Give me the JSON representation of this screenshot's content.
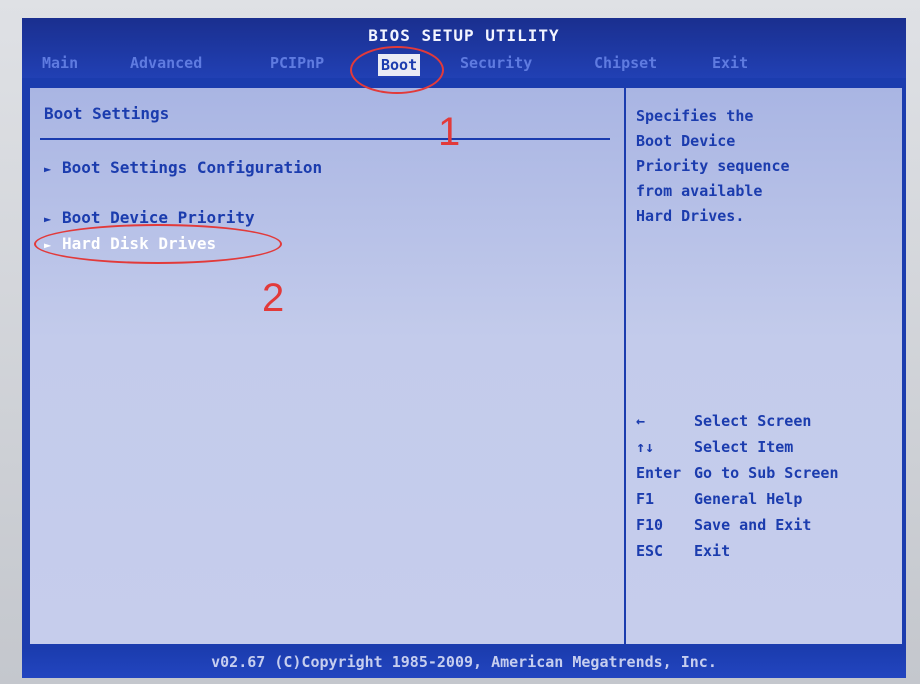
{
  "bios": {
    "title": "BIOS SETUP UTILITY",
    "menu": [
      "Main",
      "Advanced",
      "PCIPnP",
      "Boot",
      "Security",
      "Chipset",
      "Exit"
    ],
    "active_menu": "Boot"
  },
  "left_panel": {
    "section_title": "Boot Settings",
    "items": [
      {
        "arrow": "►",
        "label": "Boot Settings Configuration"
      },
      {
        "arrow": "►",
        "label": "Boot Device Priority"
      },
      {
        "arrow": "►",
        "label": "Hard Disk Drives"
      }
    ],
    "selected_item": "Hard Disk Drives"
  },
  "right_panel": {
    "help_lines": [
      "Specifies the",
      "Boot Device",
      "Priority sequence",
      "from available",
      "Hard Drives."
    ],
    "keys": [
      {
        "key": "←",
        "action": "Select Screen"
      },
      {
        "key": "↑↓",
        "action": "Select Item"
      },
      {
        "key": "Enter",
        "action": "Go to Sub Screen"
      },
      {
        "key": "F1",
        "action": "General Help"
      },
      {
        "key": "F10",
        "action": "Save and Exit"
      },
      {
        "key": "ESC",
        "action": "Exit"
      }
    ]
  },
  "footer": {
    "copyright": "v02.67 (C)Copyright 1985-2009, American Megatrends, Inc."
  },
  "annotations": {
    "label_1": "1",
    "label_2": "2",
    "color": "#e23a3a"
  },
  "colors": {
    "bios_blue": "#1b3cae",
    "panel_bg": "#c3cbeb",
    "highlight_text": "#ffffff"
  }
}
